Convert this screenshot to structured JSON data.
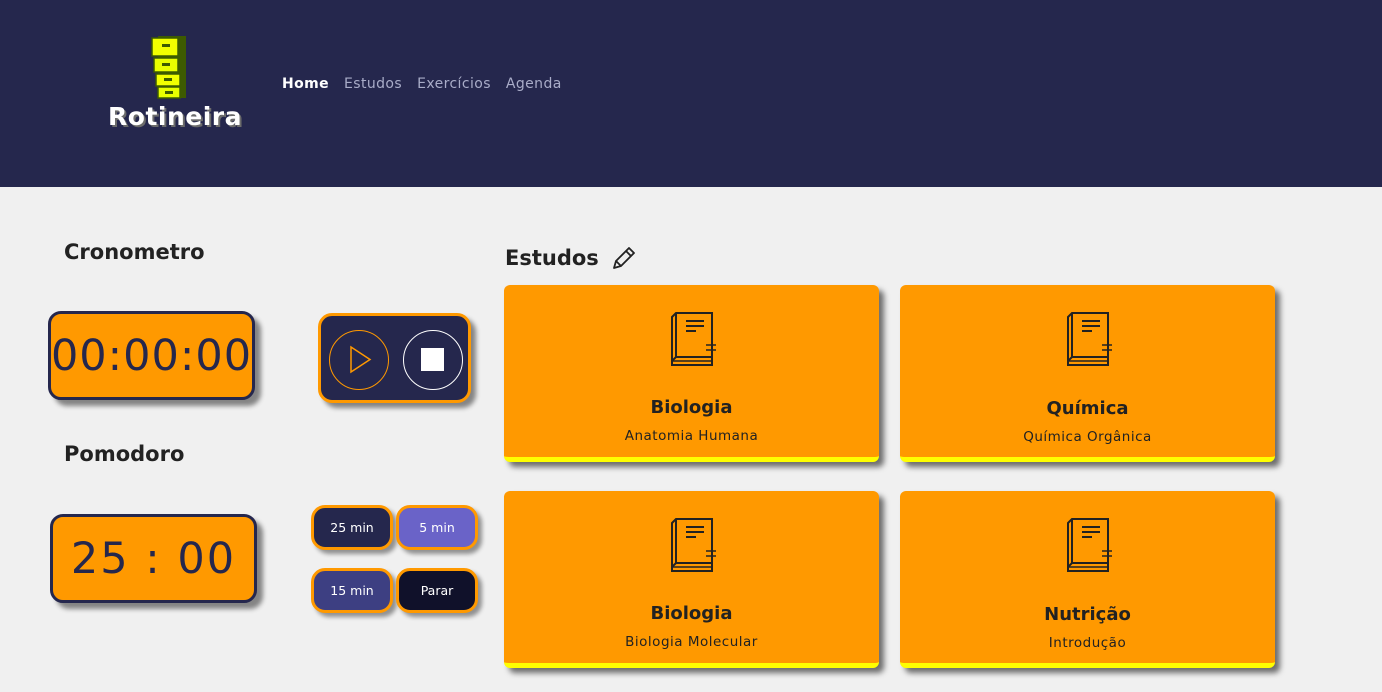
{
  "header": {
    "logo_text": "Rotineira",
    "logo_icon": "filing-cabinet-icon",
    "nav": [
      {
        "label": "Home",
        "active": true
      },
      {
        "label": "Estudos",
        "active": false
      },
      {
        "label": "Exercícios",
        "active": false
      },
      {
        "label": "Agenda",
        "active": false
      }
    ]
  },
  "cronometro": {
    "title": "Cronometro",
    "display": "00:00:00",
    "controls": {
      "play_icon": "play-icon",
      "stop_icon": "stop-icon"
    }
  },
  "pomodoro": {
    "title": "Pomodoro",
    "display": "25 : 00",
    "buttons": [
      "25 min",
      "5 min",
      "15 min",
      "Parar"
    ]
  },
  "estudos": {
    "title": "Estudos",
    "edit_icon": "pencil-icon",
    "cards": [
      {
        "subject": "Biologia",
        "topic": "Anatomia Humana",
        "icon": "book-icon"
      },
      {
        "subject": "Química",
        "topic": "Química Orgânica",
        "icon": "book-icon"
      },
      {
        "subject": "Biologia",
        "topic": "Biologia Molecular",
        "icon": "book-icon"
      },
      {
        "subject": "Nutrição",
        "topic": "Introdução",
        "icon": "book-icon"
      }
    ]
  },
  "colors": {
    "header_bg": "#25274d",
    "accent_orange": "#ff9900",
    "card_underline": "#ffff00",
    "page_bg": "#f0f0f0"
  }
}
